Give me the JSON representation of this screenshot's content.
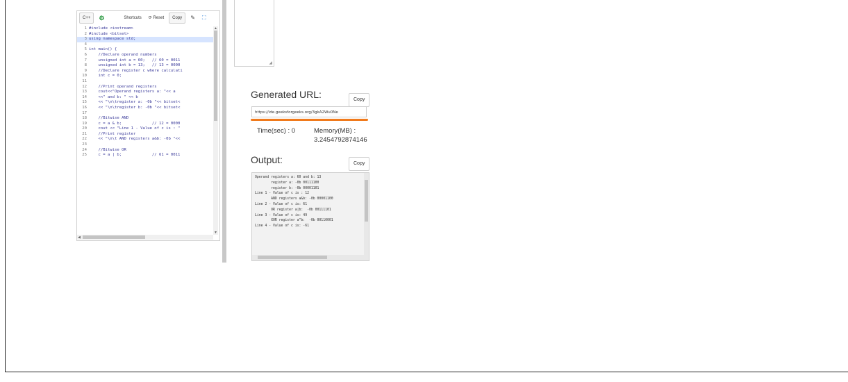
{
  "editor": {
    "language": "C++",
    "shortcuts_label": "Shortcuts",
    "reset_label": "Reset",
    "copy_label": "Copy",
    "lines": [
      {
        "n": "1",
        "t": "#include <iostream>"
      },
      {
        "n": "2",
        "t": "#include <bitset>"
      },
      {
        "n": "3",
        "t": "using namespace std;"
      },
      {
        "n": "4",
        "t": ""
      },
      {
        "n": "5",
        "t": "int main() {"
      },
      {
        "n": "6",
        "t": "    //Declare operand numbers"
      },
      {
        "n": "7",
        "t": "    unsigned int a = 60;   // 60 = 0011"
      },
      {
        "n": "8",
        "t": "    unsigned int b = 13;   // 13 = 0000"
      },
      {
        "n": "9",
        "t": "    //Declare register c where calculati"
      },
      {
        "n": "10",
        "t": "    int c = 0;"
      },
      {
        "n": "11",
        "t": ""
      },
      {
        "n": "12",
        "t": "    //Print operand registers"
      },
      {
        "n": "13",
        "t": "    cout<<\"Operand registers a: \"<< a"
      },
      {
        "n": "14",
        "t": "    <<\" and b: \" << b"
      },
      {
        "n": "15",
        "t": "    << \"\\n\\tregister a: -0b \"<< bitset<"
      },
      {
        "n": "16",
        "t": "    << \"\\n\\tregister b: -0b \"<< bitset<"
      },
      {
        "n": "17",
        "t": ""
      },
      {
        "n": "18",
        "t": "    //Bitwise AND"
      },
      {
        "n": "19",
        "t": "    c = a & b;             // 12 = 0000"
      },
      {
        "n": "20",
        "t": "    cout << \"Line 1 - Value of c is : \""
      },
      {
        "n": "21",
        "t": "    //Print register"
      },
      {
        "n": "22",
        "t": "    << \"\\n\\t AND registers a&b: -0b \"<< "
      },
      {
        "n": "23",
        "t": ""
      },
      {
        "n": "24",
        "t": "    //Bitwise OR"
      },
      {
        "n": "25",
        "t": "    c = a | b;             // 61 = 0011"
      }
    ]
  },
  "generated_url": {
    "title": "Generated URL:",
    "copy_label": "Copy",
    "url": "https://ide.geeksforgeeks.org/3gkA2Wu0Ne"
  },
  "stats": {
    "time_label": "Time(sec) : 0",
    "memory_label": "Memory(MB) :",
    "memory_value": "3.2454792874146"
  },
  "output": {
    "title": "Output:",
    "copy_label": "Copy",
    "lines": [
      "Operand registers a: 60 and b: 13",
      "        register a: -0b 00111100",
      "        register b: -0b 00001101",
      "Line 1 - Value of c is : 12",
      "        AND registers a&b: -0b 00001100",
      "Line 2 - Value of c is: 61",
      "        OR register a|b:  -0b 00111101",
      "Line 3 - Value of c is: 49",
      "        XOR register a^b:  -0b 00110001",
      "Line 4 - Value of c is: -61"
    ]
  },
  "colors": {
    "url_underline": "#f07a1c",
    "selection": "#d6e4ff",
    "code_text": "#3a3a9a"
  }
}
